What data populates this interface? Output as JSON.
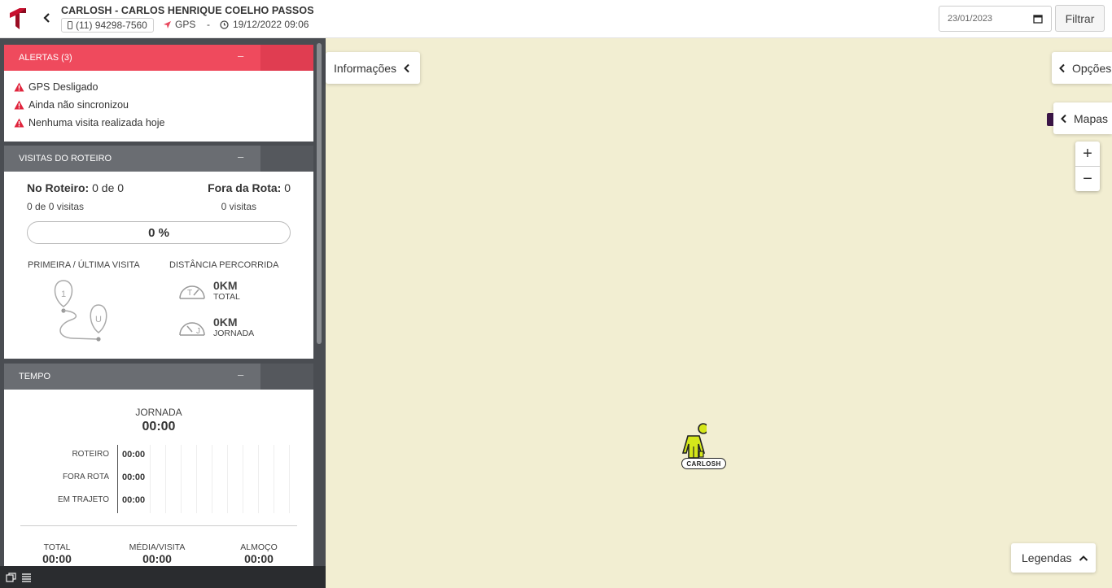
{
  "header": {
    "user_name": "CARLOSH - CARLOS HENRIQUE COELHO PASSOS",
    "phone": "(11) 94298-7560",
    "gps_label": "GPS",
    "separator": "-",
    "datetime": "19/12/2022 09:06",
    "date_value": "23/01/2023",
    "filter_label": "Filtrar",
    "colors": {
      "brand": "#c8102e",
      "gps_arrow": "#e84a5f"
    }
  },
  "alerts": {
    "title": "ALERTAS (3)",
    "collapse_symbol": "–",
    "items": [
      "GPS Desligado",
      "Ainda não sincronizou",
      "Nenhuma visita realizada hoje"
    ],
    "color": "#ef4a5d"
  },
  "visits": {
    "title": "VISITAS DO ROTEIRO",
    "collapse_symbol": "–",
    "no_roteiro_label": "No Roteiro:",
    "no_roteiro_value": "0 de 0",
    "fora_rota_label": "Fora da Rota:",
    "fora_rota_value": "0",
    "no_roteiro_sub": "0 de 0 visitas",
    "fora_rota_sub": "0 visitas",
    "progress_text": "0 %",
    "progress_fraction": 0,
    "first_last_label": "PRIMEIRA / ÚLTIMA VISITA",
    "first_pin": "1",
    "last_pin": "U",
    "distance_label": "DISTÂNCIA PERCORRIDA",
    "total_km": "0KM",
    "total_label": "TOTAL",
    "total_gauge_letter": "T",
    "jornada_km": "0KM",
    "jornada_label": "JORNADA",
    "jornada_gauge_letter": "J"
  },
  "tempo": {
    "title": "TEMPO",
    "collapse_symbol": "–",
    "jornada_label": "JORNADA",
    "jornada_value": "00:00",
    "rows": [
      {
        "label": "ROTEIRO",
        "value": "00:00"
      },
      {
        "label": "FORA ROTA",
        "value": "00:00"
      },
      {
        "label": "EM TRAJETO",
        "value": "00:00"
      }
    ],
    "stats": [
      {
        "label": "TOTAL",
        "value": "00:00"
      },
      {
        "label": "MÉDIA/VISITA",
        "value": "00:00"
      },
      {
        "label": "ALMOÇO",
        "value": "00:00"
      }
    ]
  },
  "map": {
    "info_label": "Informações",
    "options_label": "Opções",
    "maps_label": "Mapas",
    "zoom_in": "+",
    "zoom_out": "−",
    "legend_label": "Legendas",
    "marker_label": "CARLOSH",
    "background": "#f2eed2",
    "marker_color": "#d4e61a"
  },
  "icons": [
    "logo-icon",
    "back-chevron-icon",
    "phone-icon",
    "gps-arrow-icon",
    "clock-icon",
    "calendar-icon",
    "warning-icon",
    "route-icon",
    "gauge-icon",
    "chevron-left-icon",
    "chevron-up-icon",
    "person-marker-icon",
    "window-icon",
    "list-icon"
  ]
}
